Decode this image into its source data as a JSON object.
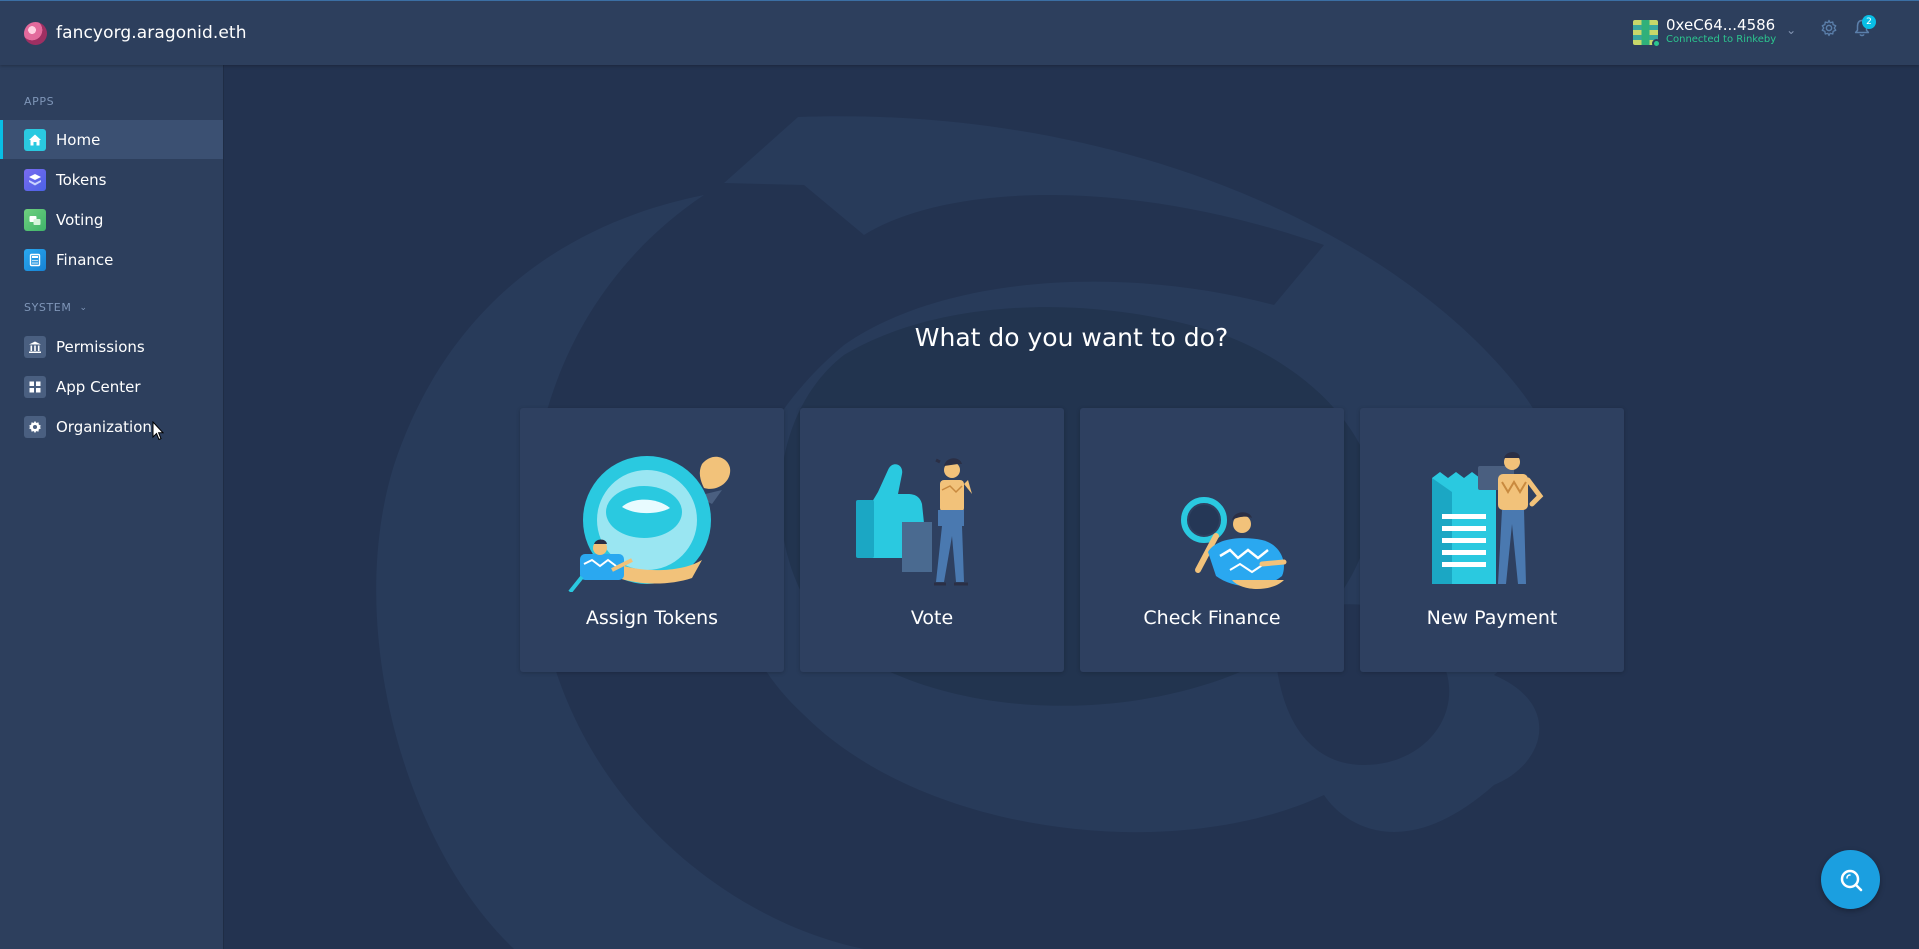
{
  "header": {
    "org_name": "fancyorg.aragonid.eth",
    "account_address": "0xeC64...4586",
    "account_network": "Connected to Rinkeby",
    "notification_count": "2",
    "colors": {
      "network_status": "#2cc68f",
      "accent": "#08bee5"
    },
    "icons": [
      "org-avatar",
      "identicon",
      "chevron-down-icon",
      "gear-icon",
      "bell-icon"
    ]
  },
  "sidebar": {
    "apps_label": "APPS",
    "apps": [
      {
        "label": "Home",
        "icon": "home-icon",
        "active": true
      },
      {
        "label": "Tokens",
        "icon": "tokens-icon",
        "active": false
      },
      {
        "label": "Voting",
        "icon": "voting-icon",
        "active": false
      },
      {
        "label": "Finance",
        "icon": "finance-icon",
        "active": false
      }
    ],
    "system_label": "SYSTEM",
    "system": [
      {
        "label": "Permissions",
        "icon": "permissions-icon"
      },
      {
        "label": "App Center",
        "icon": "app-center-icon"
      },
      {
        "label": "Organization",
        "icon": "organization-gear-icon"
      }
    ]
  },
  "main": {
    "prompt": "What do you want to do?",
    "actions": [
      {
        "label": "Assign Tokens",
        "illustration": "assign-tokens-illustration"
      },
      {
        "label": "Vote",
        "illustration": "vote-illustration"
      },
      {
        "label": "Check Finance",
        "illustration": "check-finance-illustration"
      },
      {
        "label": "New Payment",
        "illustration": "new-payment-illustration"
      }
    ]
  },
  "help": {
    "icon": "help-search-icon",
    "color": "#1b9fe0"
  }
}
